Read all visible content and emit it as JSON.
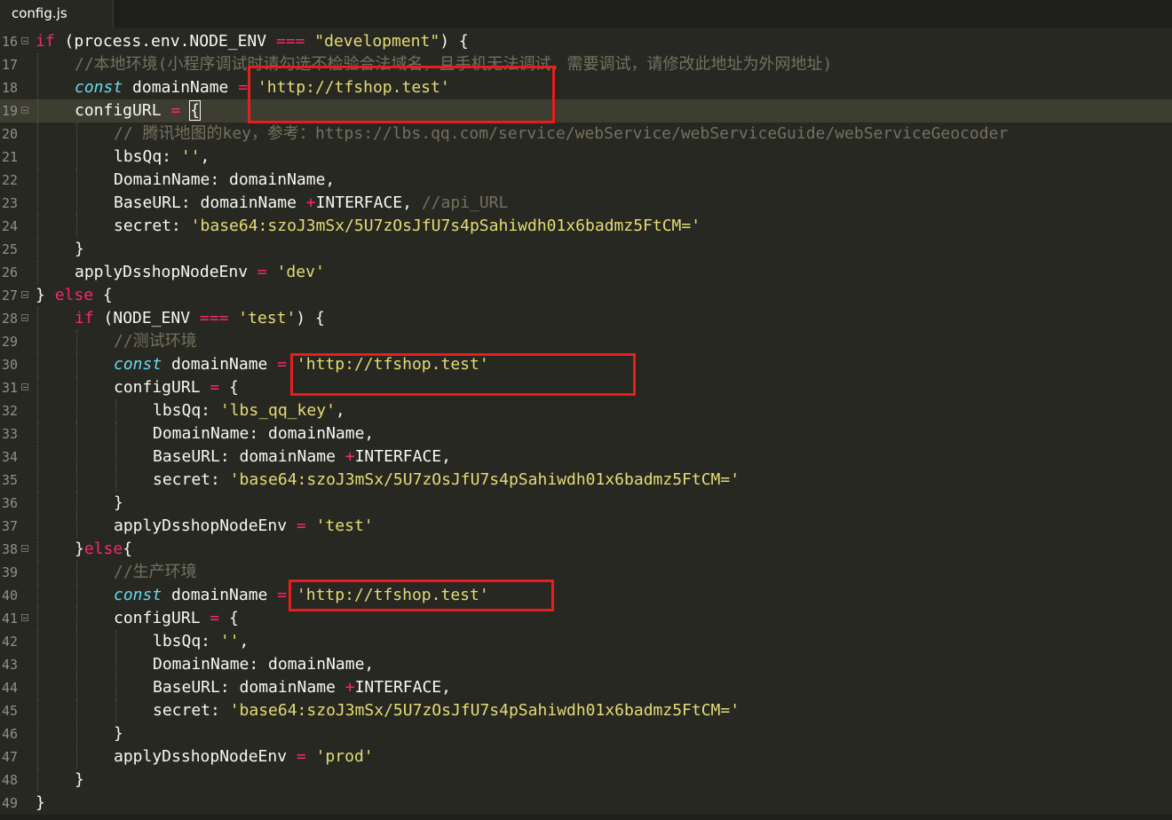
{
  "tab": {
    "title": "config.js"
  },
  "lines": [
    {
      "n": "16",
      "fold": true,
      "indent": 0,
      "tokens": [
        [
          "kw",
          "if"
        ],
        [
          "p",
          " (process.env.NODE_ENV "
        ],
        [
          "op",
          "==="
        ],
        [
          "p",
          " "
        ],
        [
          "st",
          "\"development\""
        ],
        [
          "p",
          ") {"
        ]
      ]
    },
    {
      "n": "17",
      "fold": false,
      "indent": 1,
      "tokens": [
        [
          "cm",
          "//本地环境(小程序调试时请勾选不检验合法域名，且手机无法调试，需要调试，请修改此地址为外网地址)"
        ]
      ]
    },
    {
      "n": "18",
      "fold": false,
      "indent": 1,
      "tokens": [
        [
          "sk",
          "const"
        ],
        [
          "p",
          " domainName "
        ],
        [
          "op",
          "="
        ],
        [
          "p",
          " "
        ],
        [
          "st",
          "'http://tfshop.test'"
        ]
      ]
    },
    {
      "n": "19",
      "fold": true,
      "indent": 1,
      "active": true,
      "tokens": [
        [
          "p",
          "configURL "
        ],
        [
          "op",
          "="
        ],
        [
          "p",
          " "
        ],
        [
          "br",
          "{"
        ]
      ]
    },
    {
      "n": "20",
      "fold": false,
      "indent": 2,
      "tokens": [
        [
          "cm",
          "// 腾讯地图的key，参考：https://lbs.qq.com/service/webService/webServiceGuide/webServiceGeocoder"
        ]
      ]
    },
    {
      "n": "21",
      "fold": false,
      "indent": 2,
      "tokens": [
        [
          "p",
          "lbsQq: "
        ],
        [
          "st",
          "''"
        ],
        [
          "p",
          ","
        ]
      ]
    },
    {
      "n": "22",
      "fold": false,
      "indent": 2,
      "tokens": [
        [
          "p",
          "DomainName: domainName,"
        ]
      ]
    },
    {
      "n": "23",
      "fold": false,
      "indent": 2,
      "tokens": [
        [
          "p",
          "BaseURL: domainName "
        ],
        [
          "op",
          "+"
        ],
        [
          "p",
          "INTERFACE, "
        ],
        [
          "cm",
          "//api_URL"
        ]
      ]
    },
    {
      "n": "24",
      "fold": false,
      "indent": 2,
      "tokens": [
        [
          "p",
          "secret: "
        ],
        [
          "st",
          "'base64:szoJ3mSx/5U7zOsJfU7s4pSahiwdh01x6badmz5FtCM='"
        ]
      ]
    },
    {
      "n": "25",
      "fold": false,
      "indent": 1,
      "tokens": [
        [
          "br",
          "}"
        ]
      ]
    },
    {
      "n": "26",
      "fold": false,
      "indent": 1,
      "tokens": [
        [
          "p",
          "applyDsshopNodeEnv "
        ],
        [
          "op",
          "="
        ],
        [
          "p",
          " "
        ],
        [
          "st",
          "'dev'"
        ]
      ]
    },
    {
      "n": "27",
      "fold": true,
      "indent": 0,
      "tokens": [
        [
          "p",
          "} "
        ],
        [
          "kw",
          "else"
        ],
        [
          "p",
          " {"
        ]
      ]
    },
    {
      "n": "28",
      "fold": true,
      "indent": 1,
      "tokens": [
        [
          "kw",
          "if"
        ],
        [
          "p",
          " (NODE_ENV "
        ],
        [
          "op",
          "==="
        ],
        [
          "p",
          " "
        ],
        [
          "st",
          "'test'"
        ],
        [
          "p",
          ") {"
        ]
      ]
    },
    {
      "n": "29",
      "fold": false,
      "indent": 2,
      "tokens": [
        [
          "cm",
          "//测试环境"
        ]
      ]
    },
    {
      "n": "30",
      "fold": false,
      "indent": 2,
      "tokens": [
        [
          "sk",
          "const"
        ],
        [
          "p",
          " domainName "
        ],
        [
          "op",
          "="
        ],
        [
          "p",
          " "
        ],
        [
          "st",
          "'http://tfshop.test'"
        ]
      ]
    },
    {
      "n": "31",
      "fold": true,
      "indent": 2,
      "tokens": [
        [
          "p",
          "configURL "
        ],
        [
          "op",
          "="
        ],
        [
          "p",
          " {"
        ]
      ]
    },
    {
      "n": "32",
      "fold": false,
      "indent": 3,
      "tokens": [
        [
          "p",
          "lbsQq: "
        ],
        [
          "st",
          "'lbs_qq_key'"
        ],
        [
          "p",
          ","
        ]
      ]
    },
    {
      "n": "33",
      "fold": false,
      "indent": 3,
      "tokens": [
        [
          "p",
          "DomainName: domainName,"
        ]
      ]
    },
    {
      "n": "34",
      "fold": false,
      "indent": 3,
      "tokens": [
        [
          "p",
          "BaseURL: domainName "
        ],
        [
          "op",
          "+"
        ],
        [
          "p",
          "INTERFACE,"
        ]
      ]
    },
    {
      "n": "35",
      "fold": false,
      "indent": 3,
      "tokens": [
        [
          "p",
          "secret: "
        ],
        [
          "st",
          "'base64:szoJ3mSx/5U7zOsJfU7s4pSahiwdh01x6badmz5FtCM='"
        ]
      ]
    },
    {
      "n": "36",
      "fold": false,
      "indent": 2,
      "tokens": [
        [
          "p",
          "}"
        ]
      ]
    },
    {
      "n": "37",
      "fold": false,
      "indent": 2,
      "tokens": [
        [
          "p",
          "applyDsshopNodeEnv "
        ],
        [
          "op",
          "="
        ],
        [
          "p",
          " "
        ],
        [
          "st",
          "'test'"
        ]
      ]
    },
    {
      "n": "38",
      "fold": true,
      "indent": 1,
      "tokens": [
        [
          "p",
          "}"
        ],
        [
          "kw",
          "else"
        ],
        [
          "p",
          "{"
        ]
      ]
    },
    {
      "n": "39",
      "fold": false,
      "indent": 2,
      "tokens": [
        [
          "cm",
          "//生产环境"
        ]
      ]
    },
    {
      "n": "40",
      "fold": false,
      "indent": 2,
      "tokens": [
        [
          "sk",
          "const"
        ],
        [
          "p",
          " domainName "
        ],
        [
          "op",
          "="
        ],
        [
          "p",
          " "
        ],
        [
          "st",
          "'http://tfshop.test'"
        ]
      ]
    },
    {
      "n": "41",
      "fold": true,
      "indent": 2,
      "tokens": [
        [
          "p",
          "configURL "
        ],
        [
          "op",
          "="
        ],
        [
          "p",
          " {"
        ]
      ]
    },
    {
      "n": "42",
      "fold": false,
      "indent": 3,
      "tokens": [
        [
          "p",
          "lbsQq: "
        ],
        [
          "st",
          "''"
        ],
        [
          "p",
          ","
        ]
      ]
    },
    {
      "n": "43",
      "fold": false,
      "indent": 3,
      "tokens": [
        [
          "p",
          "DomainName: domainName,"
        ]
      ]
    },
    {
      "n": "44",
      "fold": false,
      "indent": 3,
      "tokens": [
        [
          "p",
          "BaseURL: domainName "
        ],
        [
          "op",
          "+"
        ],
        [
          "p",
          "INTERFACE,"
        ]
      ]
    },
    {
      "n": "45",
      "fold": false,
      "indent": 3,
      "tokens": [
        [
          "p",
          "secret: "
        ],
        [
          "st",
          "'base64:szoJ3mSx/5U7zOsJfU7s4pSahiwdh01x6badmz5FtCM='"
        ]
      ]
    },
    {
      "n": "46",
      "fold": false,
      "indent": 2,
      "tokens": [
        [
          "p",
          "}"
        ]
      ]
    },
    {
      "n": "47",
      "fold": false,
      "indent": 2,
      "tokens": [
        [
          "p",
          "applyDsshopNodeEnv "
        ],
        [
          "op",
          "="
        ],
        [
          "p",
          " "
        ],
        [
          "st",
          "'prod'"
        ]
      ]
    },
    {
      "n": "48",
      "fold": false,
      "indent": 1,
      "tokens": [
        [
          "p",
          "}"
        ]
      ]
    },
    {
      "n": "49",
      "fold": false,
      "indent": 0,
      "tokens": [
        [
          "p",
          "}"
        ]
      ]
    }
  ],
  "colors": {
    "background": "#272822",
    "keyword": "#f92672",
    "string": "#e6db74",
    "comment": "#75715e",
    "storage": "#66d9ef",
    "highlight_box": "#e61e1e"
  }
}
